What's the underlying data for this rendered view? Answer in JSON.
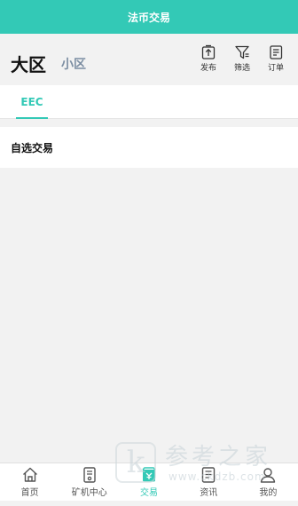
{
  "header": {
    "title": "法币交易"
  },
  "region": {
    "big": "大区",
    "small": "小区"
  },
  "tools": [
    {
      "label": "发布",
      "icon": "publish-icon"
    },
    {
      "label": "筛选",
      "icon": "filter-icon"
    },
    {
      "label": "订单",
      "icon": "order-icon"
    }
  ],
  "tabs": [
    {
      "label": "EEC",
      "active": true
    }
  ],
  "section": {
    "title": "自选交易"
  },
  "nav": [
    {
      "label": "首页",
      "icon": "home-icon"
    },
    {
      "label": "矿机中心",
      "icon": "miner-icon"
    },
    {
      "label": "交易",
      "icon": "trade-icon",
      "active": true
    },
    {
      "label": "资讯",
      "icon": "news-icon"
    },
    {
      "label": "我的",
      "icon": "user-icon"
    }
  ],
  "watermark": {
    "cn": "参考之家",
    "url": "www.ckdzb.com",
    "logo": "k"
  },
  "colors": {
    "accent": "#33c9b6",
    "background": "#f2f2f2"
  }
}
